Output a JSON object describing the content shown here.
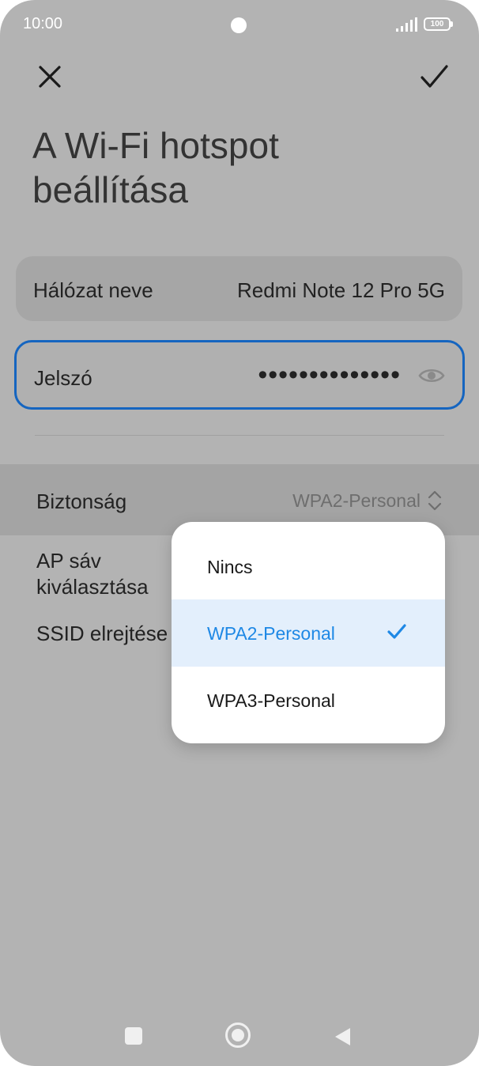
{
  "status_bar": {
    "time": "10:00",
    "battery": "100"
  },
  "header": {
    "title": "A Wi-Fi hotspot beállítása"
  },
  "network": {
    "label": "Hálózat neve",
    "value": "Redmi Note 12 Pro 5G"
  },
  "password": {
    "label": "Jelszó",
    "value": "••••••••••••••"
  },
  "security": {
    "label": "Biztonság",
    "value": "WPA2-Personal"
  },
  "ap_band": {
    "label": "AP sáv kiválasztása"
  },
  "ssid_hidden": {
    "label": "SSID elrejtése"
  },
  "dropdown": {
    "options": [
      {
        "label": "Nincs",
        "selected": false
      },
      {
        "label": "WPA2-Personal",
        "selected": true
      },
      {
        "label": "WPA3-Personal",
        "selected": false
      }
    ]
  },
  "icons": {
    "close": "close-icon",
    "confirm": "check-icon",
    "eye": "eye-icon",
    "updown": "chevron-updown-icon",
    "selected": "check-icon"
  },
  "colors": {
    "accent": "#1e88e5",
    "focus_border": "#1565c0",
    "selected_bg": "#e3effc"
  }
}
